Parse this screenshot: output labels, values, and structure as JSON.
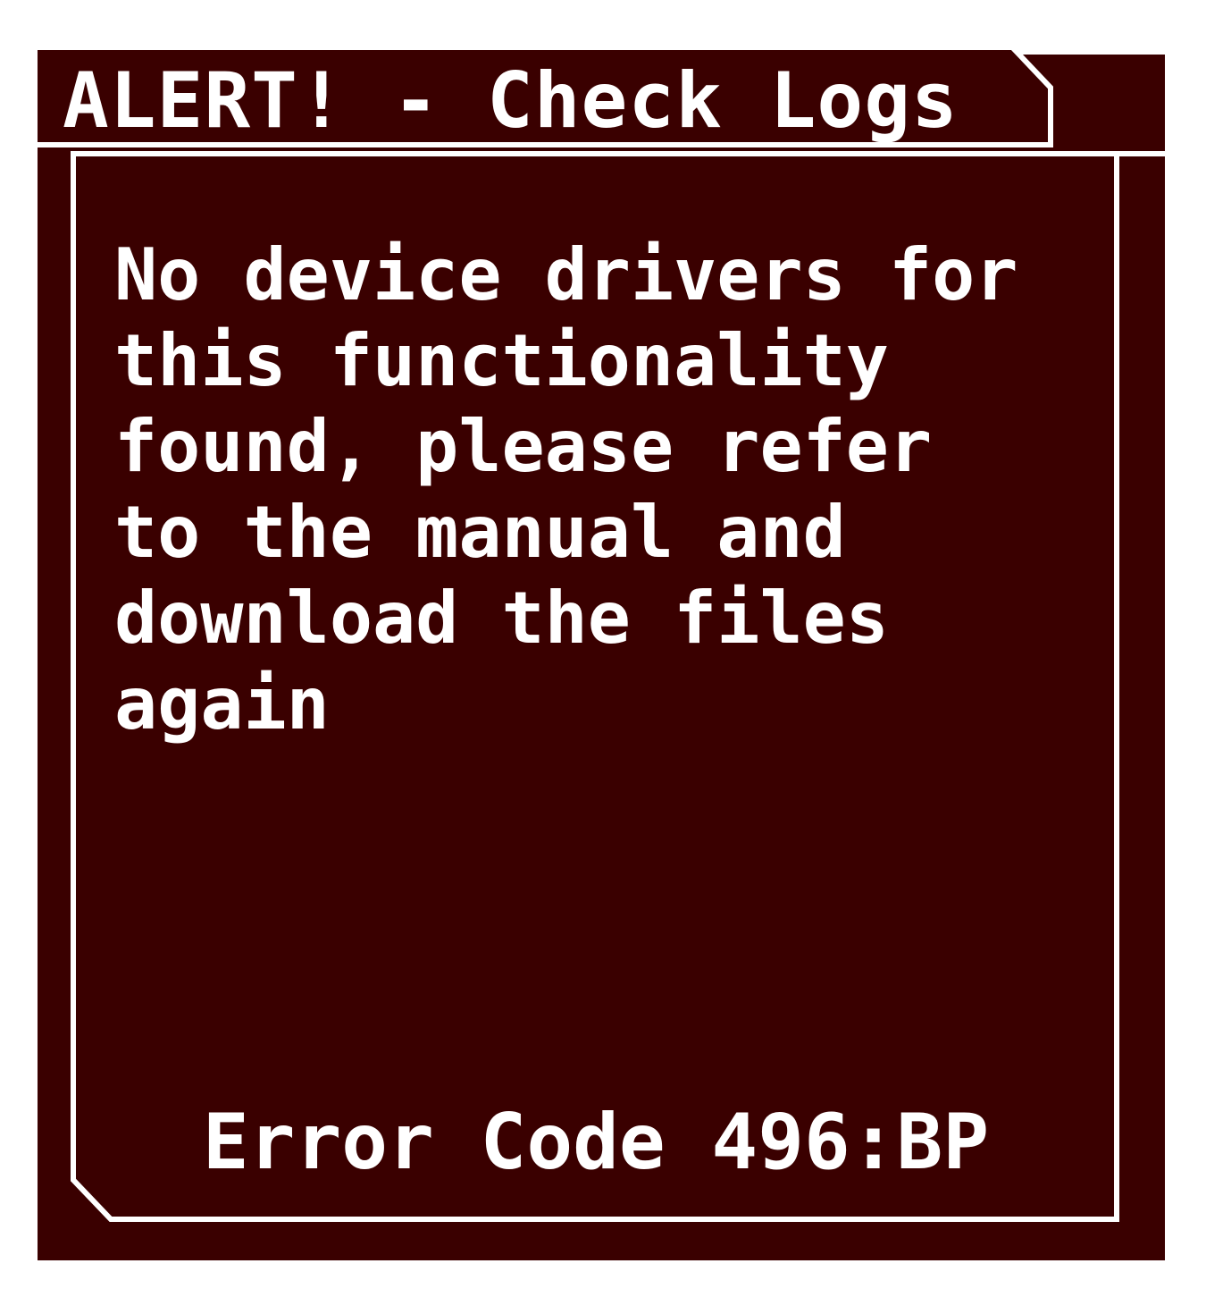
{
  "dialog": {
    "title": "ALERT! - Check Logs",
    "message": "No device drivers for\nthis functionality\nfound, please refer\nto the manual and\ndownload the files\nagain",
    "error_code": "Error Code 496:BP"
  },
  "colors": {
    "background": "#3a0000",
    "border": "#ffffff",
    "text": "#ffffff"
  }
}
